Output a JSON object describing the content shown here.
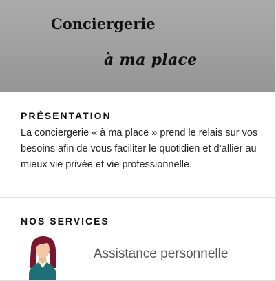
{
  "hero": {
    "title": "Conciergerie",
    "subtitle": "à ma place"
  },
  "presentation": {
    "heading": "PRÉSENTATION",
    "text": "La conciergerie « à ma place » prend le relais sur vos besoins afin de vous faciliter le quotidien et d’allier au mieux vie privée et vie professionnelle."
  },
  "services": {
    "heading": "NOS SERVICES",
    "items": [
      {
        "label": "Assistance personnelle",
        "icon": "woman-avatar-icon"
      }
    ]
  },
  "colors": {
    "hero_background": "#a3a3a3",
    "heading_text": "#111111",
    "body_text": "#222222",
    "service_text": "#555555",
    "divider": "#dddddd"
  }
}
